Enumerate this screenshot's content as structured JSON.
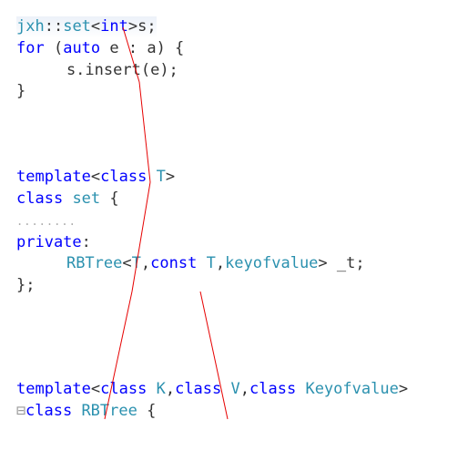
{
  "block1": {
    "line1": {
      "ns": "jxh",
      "scope": "::",
      "set": "set",
      "lt": "<",
      "int": "int",
      "gt": ">",
      "var": "s",
      "semi": ";"
    },
    "line2": {
      "for": "for",
      "sp": " (",
      "auto": "auto",
      "sp2": " e : a) {"
    },
    "line3": {
      "indent": "    s.",
      "insert": "insert",
      "rest": "(e);"
    },
    "line4": {
      "text": "}"
    }
  },
  "block2": {
    "line1": {
      "template": "template",
      "lt": "<",
      "class": "class",
      "sp": " ",
      "T": "T",
      "gt": ">"
    },
    "line2": {
      "class": "class",
      "sp": " ",
      "set": "set",
      "brace": " {"
    },
    "line3": {
      "dots": "........"
    },
    "line4": {
      "private": "private",
      "colon": ":"
    },
    "line5": {
      "indent": "    ",
      "rbtree": "RBTree",
      "lt": "<",
      "T1": "T",
      "comma1": ",",
      "const": "const",
      "sp": " ",
      "T2": "T",
      "comma2": ",",
      "keyof": "keyofvalue",
      "gt": ">",
      "var": " _t",
      "semi": ";"
    },
    "line6": {
      "text": "};"
    }
  },
  "block3": {
    "line1": {
      "template": "template",
      "lt": "<",
      "class1": "class",
      "sp1": " ",
      "K": "K",
      "comma1": ",",
      "class2": "class",
      "sp2": " ",
      "V": "V",
      "comma2": ",",
      "class3": "class",
      "sp3": " ",
      "Keyof": "Keyofvalue",
      "gt": ">"
    },
    "line2": {
      "fold": "⊟",
      "class": "class",
      "sp": " ",
      "rbtree": "RBTree",
      "brace": " {"
    }
  }
}
